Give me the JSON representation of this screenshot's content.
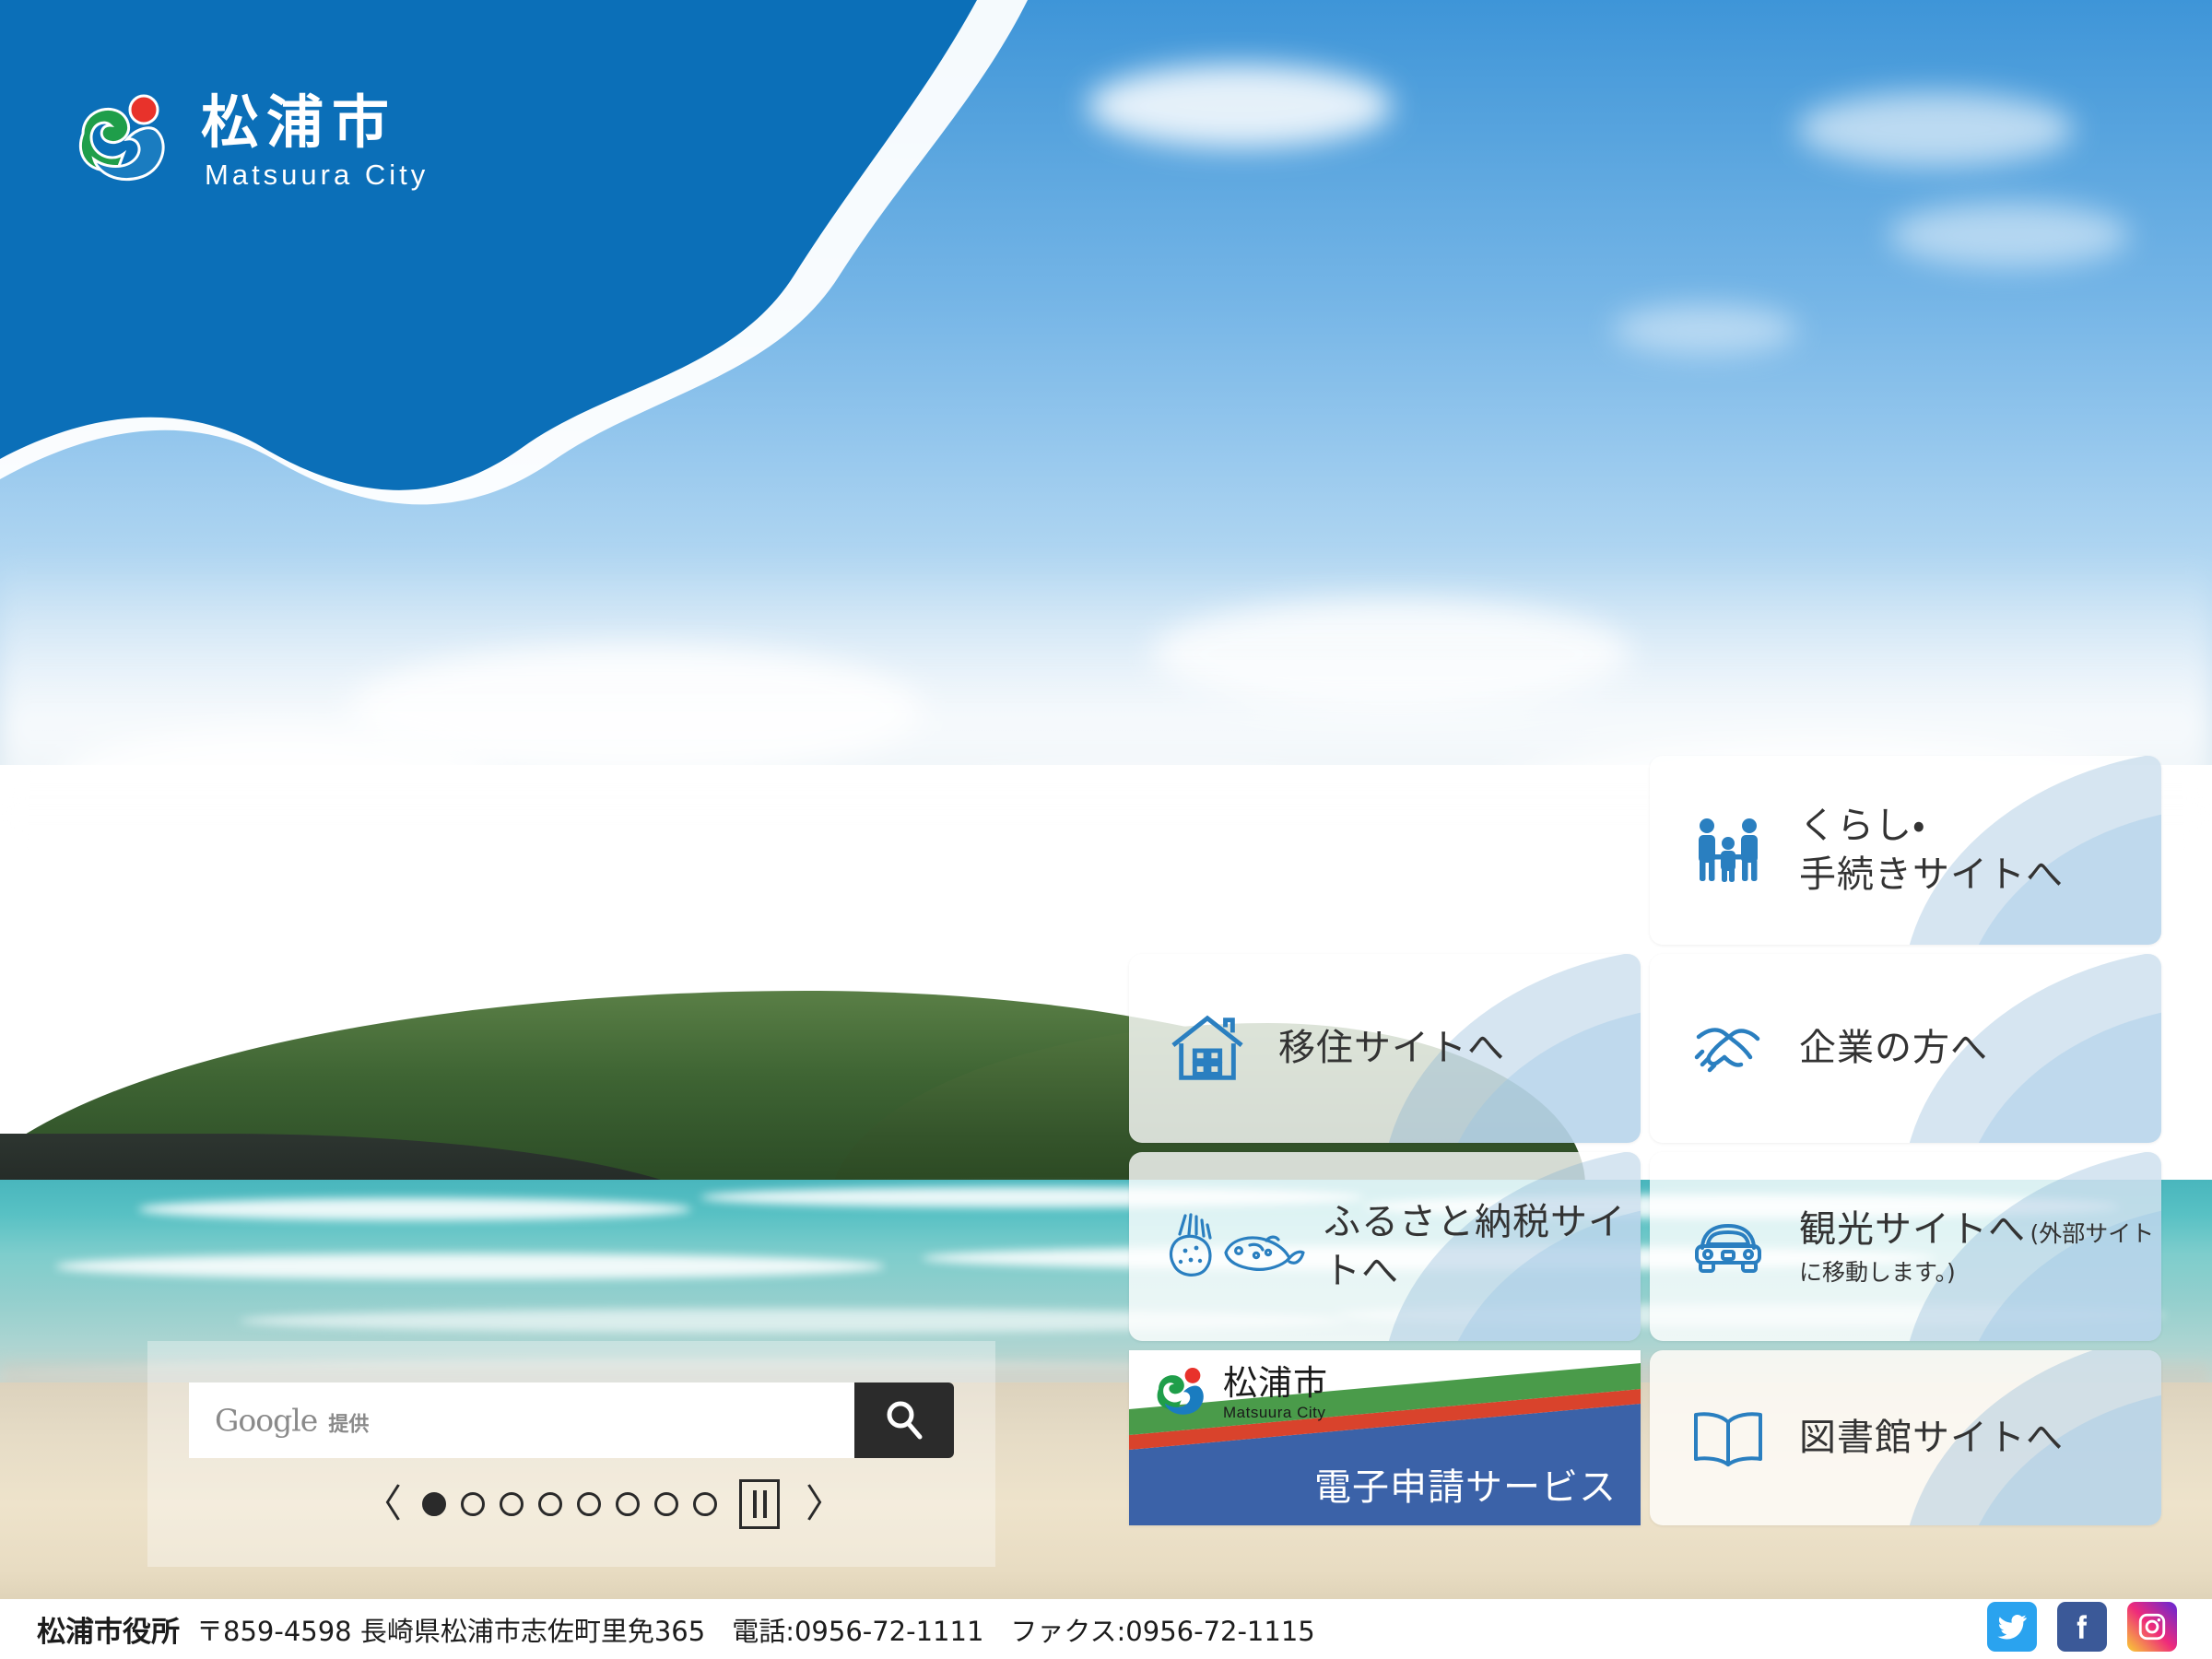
{
  "site": {
    "logo_jp": "松浦市",
    "logo_en": "Matsuura City"
  },
  "colors": {
    "header_blue": "#0b6fb8",
    "accent_blue": "#1a7cc0",
    "icon_blue": "#2a7fc0",
    "search_button": "#2b2b2b",
    "stripe_green": "#4a9b4a",
    "stripe_red": "#d9432c",
    "stripe_blue": "#3b62a8",
    "twitter": "#2aa3ef",
    "facebook": "#3b5998"
  },
  "cards": [
    {
      "id": "kurashi",
      "icon": "family-people-icon",
      "title": "くらし・\n手続きサイトへ",
      "sub": ""
    },
    {
      "id": "ijyu",
      "icon": "house-icon",
      "title": "移住サイトへ",
      "sub": ""
    },
    {
      "id": "kigyo",
      "icon": "handshake-icon",
      "title": "企業の方へ",
      "sub": ""
    },
    {
      "id": "furusato",
      "icon": "fish-and-vegetable-icon",
      "title": "ふるさと納税サイトへ",
      "sub": ""
    },
    {
      "id": "kanko",
      "icon": "car-icon",
      "title": "観光サイトへ",
      "sub": "(外部サイトに移動します。)"
    },
    {
      "id": "denshi",
      "icon": "matsuura-logo-banner",
      "title": "電子申請サービス",
      "logo_jp": "松浦市",
      "logo_en": "Matsuura City"
    },
    {
      "id": "toshokan",
      "icon": "open-book-icon",
      "title": "図書館サイトへ",
      "sub": ""
    }
  ],
  "search": {
    "placeholder_brand": "Google",
    "placeholder_suffix": "提供",
    "value": "",
    "button_icon": "search-icon"
  },
  "carousel": {
    "prev_glyph": "〈",
    "next_glyph": "〉",
    "pause_icon": "pause-icon",
    "total_slides": 8,
    "active_slide": 1
  },
  "footer": {
    "office_name": "松浦市役所",
    "address": "〒859-4598 長崎県松浦市志佐町里免365　電話:0956-72-1111　ファクス:0956-72-1115",
    "social": [
      {
        "id": "twitter",
        "icon": "twitter-icon"
      },
      {
        "id": "facebook",
        "icon": "facebook-icon"
      },
      {
        "id": "instagram",
        "icon": "instagram-icon"
      }
    ]
  }
}
